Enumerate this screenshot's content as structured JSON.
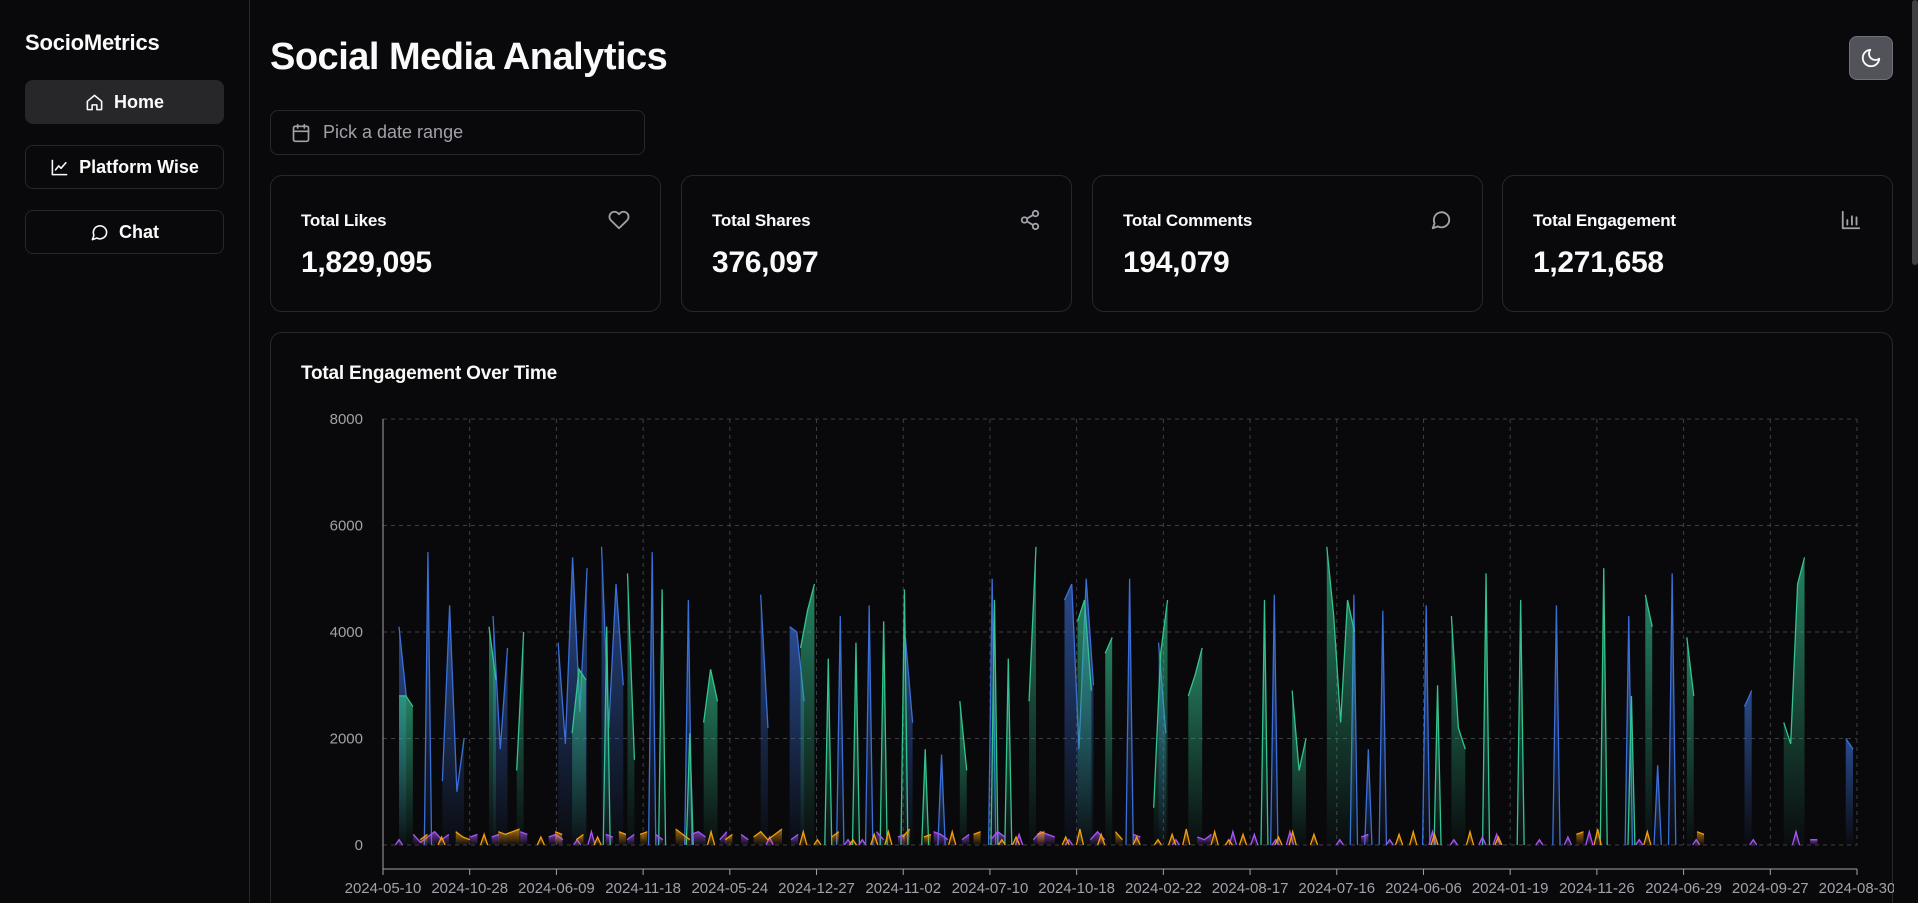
{
  "app": {
    "brand": "SocioMetrics",
    "title": "Social Media Analytics"
  },
  "nav": [
    {
      "label": "Home",
      "icon": "home-icon",
      "active": true
    },
    {
      "label": "Platform Wise",
      "icon": "line-chart-icon",
      "active": false
    },
    {
      "label": "Chat",
      "icon": "message-circle-icon",
      "active": false
    }
  ],
  "date_picker": {
    "placeholder": "Pick a date range",
    "icon": "calendar-icon"
  },
  "theme_toggle": {
    "icon": "moon-icon"
  },
  "stats": [
    {
      "label": "Total Likes",
      "value": "1,829,095",
      "icon": "heart-icon"
    },
    {
      "label": "Total Shares",
      "value": "376,097",
      "icon": "share-icon"
    },
    {
      "label": "Total Comments",
      "value": "194,079",
      "icon": "comment-icon"
    },
    {
      "label": "Total Engagement",
      "value": "1,271,658",
      "icon": "bar-chart-icon"
    }
  ],
  "chart_data": {
    "type": "area",
    "title": "Total Engagement Over Time",
    "ylim": [
      0,
      8000
    ],
    "yticks": [
      0,
      2000,
      4000,
      6000,
      8000
    ],
    "xtick_labels": [
      "2024-05-10",
      "2024-10-28",
      "2024-06-09",
      "2024-11-18",
      "2024-05-24",
      "2024-12-27",
      "2024-11-02",
      "2024-07-10",
      "2024-10-18",
      "2024-02-22",
      "2024-08-17",
      "2024-07-16",
      "2024-06-06",
      "2024-01-19",
      "2024-11-26",
      "2024-06-29",
      "2024-09-27",
      "2024-08-30"
    ],
    "grid": true,
    "colors": {
      "blue": "#3b6fd6",
      "green": "#34c38f",
      "purple": "#a855f7",
      "orange": "#f59e0b"
    },
    "series": [
      {
        "color": "#3b6fd6",
        "values": [
          4100,
          2800,
          0,
          0,
          5500,
          0,
          1200,
          4500,
          1000,
          2000,
          0,
          0,
          0,
          4300,
          1800,
          3700,
          0,
          0,
          0,
          0,
          0,
          0,
          3800,
          1900,
          5400,
          2500,
          5200,
          0,
          5600,
          2200,
          4900,
          3000,
          0,
          0,
          0,
          5500,
          0,
          0,
          0,
          0,
          4600,
          0,
          0,
          0,
          0,
          0,
          0,
          0,
          0,
          0,
          4700,
          2200,
          0,
          0,
          4100,
          4000,
          2700,
          0,
          0,
          0,
          0,
          4300,
          0,
          0,
          0,
          4500,
          0,
          0,
          0,
          0,
          3900,
          2300,
          0,
          0,
          0,
          1700,
          0,
          0,
          0,
          0,
          0,
          0,
          5000,
          0,
          0,
          0,
          0,
          0,
          0,
          0,
          0,
          0,
          4600,
          4900,
          1800,
          5000,
          3000,
          0,
          0,
          0,
          0,
          5000,
          0,
          0,
          0,
          3800,
          2100,
          0,
          0,
          0,
          0,
          0,
          0,
          0,
          0,
          0,
          0,
          0,
          0,
          0,
          0,
          4700,
          0,
          0,
          0,
          0,
          0,
          0,
          0,
          0,
          0,
          0,
          4700,
          0,
          1800,
          0,
          4400,
          0,
          0,
          0,
          0,
          0,
          4500,
          0,
          0,
          0,
          0,
          0,
          0,
          0,
          0,
          0,
          0,
          0,
          0,
          0,
          0,
          0,
          0,
          0,
          4500,
          0,
          0,
          0,
          0,
          0,
          0,
          0,
          0,
          0,
          4300,
          0,
          0,
          0,
          1500,
          0,
          5100,
          0,
          0,
          0,
          0,
          0,
          0,
          0,
          0,
          0,
          2600,
          2900,
          0,
          0,
          0,
          0,
          0,
          0,
          0,
          0,
          0,
          0,
          0,
          0,
          2000,
          1800
        ]
      },
      {
        "color": "#34c38f",
        "values": [
          2800,
          2800,
          2600,
          0,
          0,
          0,
          0,
          0,
          0,
          0,
          0,
          0,
          0,
          4100,
          3100,
          0,
          0,
          1400,
          4000,
          0,
          0,
          0,
          0,
          0,
          0,
          2100,
          3300,
          3100,
          0,
          0,
          4100,
          0,
          0,
          5100,
          1600,
          0,
          0,
          0,
          4800,
          0,
          0,
          0,
          2100,
          0,
          2300,
          3300,
          2700,
          0,
          0,
          0,
          0,
          0,
          0,
          0,
          0,
          0,
          0,
          0,
          3700,
          4400,
          4900,
          0,
          3500,
          0,
          0,
          0,
          3800,
          0,
          0,
          0,
          4200,
          0,
          0,
          4800,
          0,
          0,
          1800,
          0,
          0,
          0,
          0,
          2700,
          1400,
          0,
          0,
          0,
          4600,
          0,
          3500,
          0,
          0,
          2700,
          5600,
          0,
          0,
          0,
          0,
          0,
          4200,
          4600,
          2900,
          0,
          3600,
          3900,
          0,
          0,
          0,
          0,
          0,
          700,
          3600,
          4600,
          0,
          0,
          2800,
          3200,
          3700,
          0,
          0,
          0,
          0,
          0,
          0,
          0,
          0,
          4600,
          0,
          0,
          0,
          2900,
          1400,
          2000,
          0,
          0,
          5600,
          4300,
          2300,
          4600,
          4000,
          0,
          0,
          0,
          0,
          0,
          0,
          0,
          0,
          0,
          0,
          0,
          3000,
          0,
          4300,
          2200,
          1800,
          0,
          0,
          5100,
          0,
          0,
          0,
          0,
          4600,
          0,
          0,
          0,
          0,
          0,
          0,
          0,
          0,
          0,
          0,
          0,
          5200,
          0,
          0,
          0,
          2800,
          0,
          4700,
          4100,
          0,
          0,
          0,
          0,
          3900,
          2800,
          0,
          0,
          0,
          0,
          0,
          0,
          0,
          0,
          0,
          0,
          0,
          0,
          2300,
          1900,
          4900,
          5400,
          0,
          0,
          0,
          0,
          0,
          0,
          0
        ]
      },
      {
        "color": "#a855f7",
        "values": [
          100,
          0,
          200,
          50,
          150,
          250,
          100,
          200,
          0,
          0,
          150,
          200,
          0,
          150,
          200,
          0,
          0,
          250,
          200,
          0,
          0,
          150,
          200,
          100,
          0,
          100,
          0,
          250,
          0,
          200,
          150,
          0,
          100,
          200,
          0,
          0,
          200,
          100,
          0,
          0,
          0,
          200,
          250,
          150,
          0,
          100,
          250,
          0,
          200,
          100,
          0,
          0,
          150,
          0,
          0,
          100,
          200,
          0,
          0,
          0,
          0,
          0,
          0,
          100,
          0,
          100,
          0,
          250,
          100,
          0,
          150,
          200,
          0,
          0,
          0,
          250,
          200,
          100,
          0,
          100,
          200,
          0,
          0,
          100,
          250,
          150,
          0,
          200,
          0,
          100,
          250,
          200,
          150,
          0,
          100,
          0,
          0,
          100,
          250,
          100,
          0,
          0,
          0,
          200,
          150,
          0,
          0,
          0,
          0,
          100,
          0,
          0,
          150,
          100,
          200,
          0,
          0,
          250,
          0,
          0,
          200,
          0,
          0,
          100,
          0,
          250,
          0,
          0,
          0,
          0,
          0,
          0,
          100,
          0,
          0,
          150,
          200,
          0,
          0,
          100,
          0,
          0,
          0,
          0,
          0,
          250,
          0,
          0,
          100,
          0,
          0,
          0,
          150,
          0,
          200,
          0,
          0,
          0,
          0,
          0,
          100,
          0,
          0,
          0,
          150,
          0,
          0,
          250,
          0,
          0,
          0,
          0,
          0,
          0,
          100,
          0,
          0,
          0,
          0,
          0,
          0,
          0,
          100,
          0,
          0,
          0,
          0,
          0,
          0,
          0,
          100,
          0,
          0,
          0,
          0,
          0,
          250,
          0,
          100,
          100,
          0,
          0,
          0,
          0,
          0
        ]
      },
      {
        "color": "#f59e0b",
        "values": [
          0,
          0,
          0,
          100,
          200,
          0,
          150,
          0,
          250,
          150,
          100,
          0,
          200,
          0,
          250,
          200,
          250,
          300,
          0,
          0,
          150,
          0,
          250,
          200,
          0,
          100,
          200,
          0,
          150,
          0,
          0,
          250,
          200,
          0,
          200,
          250,
          0,
          0,
          0,
          300,
          200,
          100,
          0,
          0,
          250,
          0,
          100,
          200,
          0,
          0,
          150,
          250,
          100,
          200,
          300,
          0,
          0,
          250,
          0,
          100,
          0,
          150,
          250,
          0,
          100,
          0,
          0,
          200,
          0,
          250,
          0,
          150,
          300,
          0,
          150,
          200,
          0,
          0,
          250,
          0,
          0,
          200,
          250,
          0,
          0,
          100,
          0,
          150,
          0,
          0,
          200,
          250,
          0,
          0,
          150,
          0,
          300,
          0,
          0,
          200,
          0,
          250,
          100,
          0,
          150,
          0,
          0,
          100,
          0,
          200,
          0,
          300,
          0,
          0,
          0,
          250,
          0,
          100,
          0,
          200,
          0,
          0,
          0,
          0,
          150,
          0,
          250,
          0,
          0,
          200,
          0,
          0,
          0,
          0,
          0,
          0,
          0,
          0,
          0,
          0,
          0,
          200,
          0,
          250,
          0,
          0,
          200,
          0,
          0,
          0,
          0,
          250,
          0,
          0,
          0,
          150,
          0,
          0,
          0,
          0,
          0,
          0,
          0,
          0,
          0,
          0,
          200,
          250,
          0,
          300,
          0,
          0,
          0,
          0,
          0,
          0,
          250,
          0,
          0,
          0,
          0,
          0,
          0,
          250,
          200,
          0,
          0,
          0,
          0,
          0,
          0,
          0,
          0,
          0,
          0,
          0,
          0,
          0,
          0,
          0,
          0,
          0,
          0,
          0,
          0,
          0
        ]
      }
    ]
  }
}
